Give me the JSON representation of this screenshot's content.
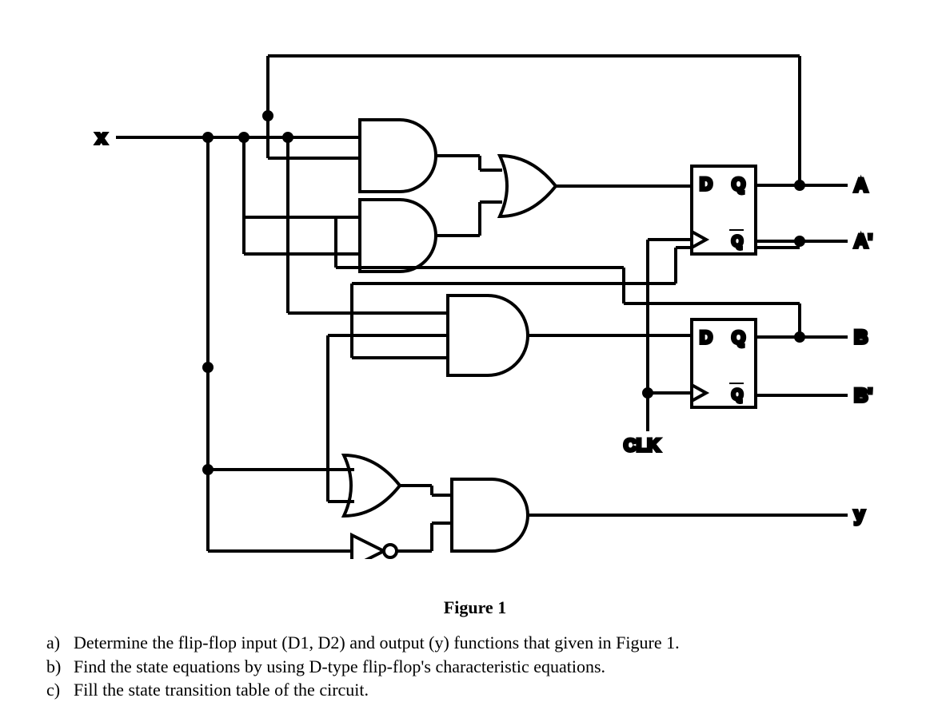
{
  "labels": {
    "x": "x",
    "y": "y",
    "A": "A",
    "Ap": "A'",
    "B": "B",
    "Bp": "B'",
    "D": "D",
    "Q": "Q",
    "Qb": "Q",
    "CLK": "CLK",
    "figure": "Figure 1"
  },
  "questions": {
    "a": {
      "letter": "a)",
      "text": "Determine the flip-flop input (D1, D2) and output (y) functions that given in Figure 1."
    },
    "b": {
      "letter": "b)",
      "text": "Find the state equations by using D-type flip-flop's characteristic equations."
    },
    "c": {
      "letter": "c)",
      "text": "Fill the state transition table of the circuit."
    }
  }
}
